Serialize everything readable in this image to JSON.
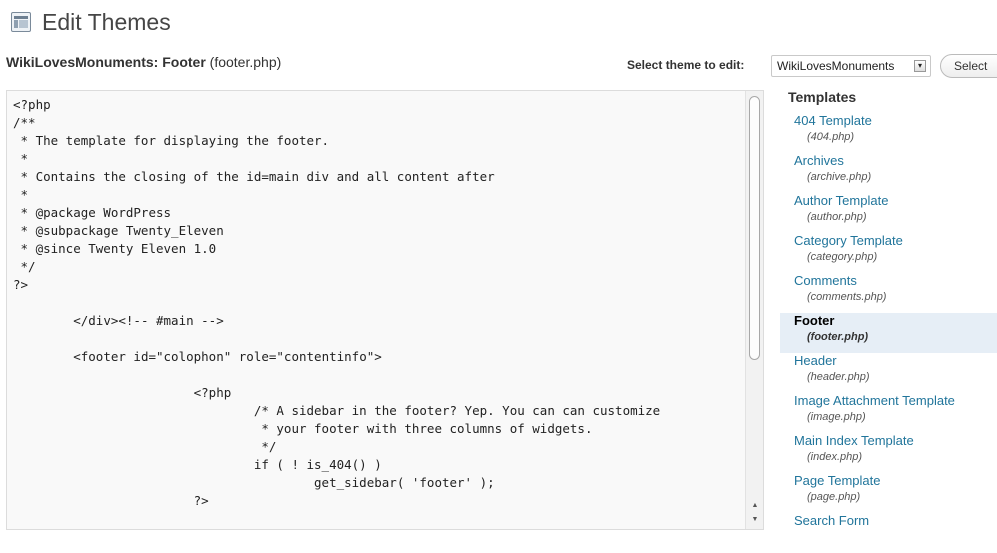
{
  "page": {
    "title": "Edit Themes",
    "icon": "themes-editor-icon"
  },
  "file_heading": {
    "theme": "WikiLovesMonuments: Footer",
    "file": "(footer.php)"
  },
  "theme_picker": {
    "label": "Select theme to edit:",
    "selected": "WikiLovesMonuments",
    "button": "Select"
  },
  "editor": {
    "code": "<?php\n/**\n * The template for displaying the footer.\n *\n * Contains the closing of the id=main div and all content after\n *\n * @package WordPress\n * @subpackage Twenty_Eleven\n * @since Twenty Eleven 1.0\n */\n?>\n\n\t</div><!-- #main -->\n\n\t<footer id=\"colophon\" role=\"contentinfo\">\n\n\t\t\t<?php\n\t\t\t\t/* A sidebar in the footer? Yep. You can can customize\n\t\t\t\t * your footer with three columns of widgets.\n\t\t\t\t */\n\t\t\t\tif ( ! is_404() )\n\t\t\t\t\tget_sidebar( 'footer' );\n\t\t\t?>"
  },
  "templates": {
    "title": "Templates",
    "items": [
      {
        "name": "404 Template",
        "file": "(404.php)"
      },
      {
        "name": "Archives",
        "file": "(archive.php)"
      },
      {
        "name": "Author Template",
        "file": "(author.php)"
      },
      {
        "name": "Category Template",
        "file": "(category.php)"
      },
      {
        "name": "Comments",
        "file": "(comments.php)"
      },
      {
        "name": "Footer",
        "file": "(footer.php)",
        "active": true
      },
      {
        "name": "Header",
        "file": "(header.php)"
      },
      {
        "name": "Image Attachment Template",
        "file": "(image.php)"
      },
      {
        "name": "Main Index Template",
        "file": "(index.php)"
      },
      {
        "name": "Page Template",
        "file": "(page.php)"
      },
      {
        "name": "Search Form",
        "file": ""
      }
    ]
  },
  "colors": {
    "link": "#21759b",
    "active_bg": "#e6eef6",
    "editor_bg": "#f9f9f9"
  }
}
